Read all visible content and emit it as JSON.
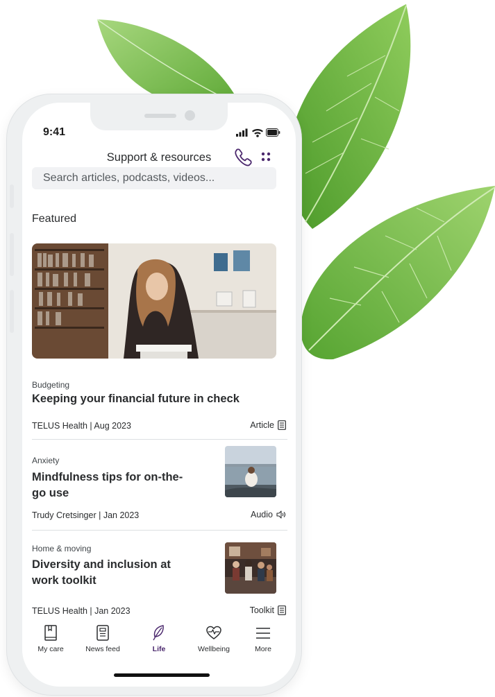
{
  "status_bar": {
    "time": "9:41"
  },
  "header": {
    "title": "Support & resources"
  },
  "search": {
    "placeholder": "Search articles, podcasts, videos..."
  },
  "featured": {
    "section_title": "Featured",
    "category": "Budgeting",
    "title": "Keeping your financial future in check",
    "meta": "TELUS Health | Aug 2023",
    "type": "Article",
    "type_icon": "document-icon"
  },
  "cards": [
    {
      "category": "Anxiety",
      "title_line1": "Mindfulness tips for on-the-",
      "title_line2": "go use",
      "meta": "Trudy Cretsinger | Jan 2023",
      "type": "Audio",
      "type_icon": "speaker-icon"
    },
    {
      "category": "Home & moving",
      "title_line1": "Diversity and inclusion at",
      "title_line2": "work toolkit",
      "meta": "TELUS Health | Jan 2023",
      "type": "Toolkit",
      "type_icon": "document-icon"
    }
  ],
  "tabs": [
    {
      "label": "My care",
      "icon": "book-icon",
      "active": false
    },
    {
      "label": "News feed",
      "icon": "news-icon",
      "active": false
    },
    {
      "label": "Life",
      "icon": "leaf-icon",
      "active": true
    },
    {
      "label": "Wellbeing",
      "icon": "heart-pulse-icon",
      "active": false
    },
    {
      "label": "More",
      "icon": "menu-icon",
      "active": false
    }
  ],
  "colors": {
    "accent": "#4b286d",
    "text": "#2a2c2e",
    "search_bg": "#f1f2f4",
    "leaf_green": "#66b33c"
  }
}
